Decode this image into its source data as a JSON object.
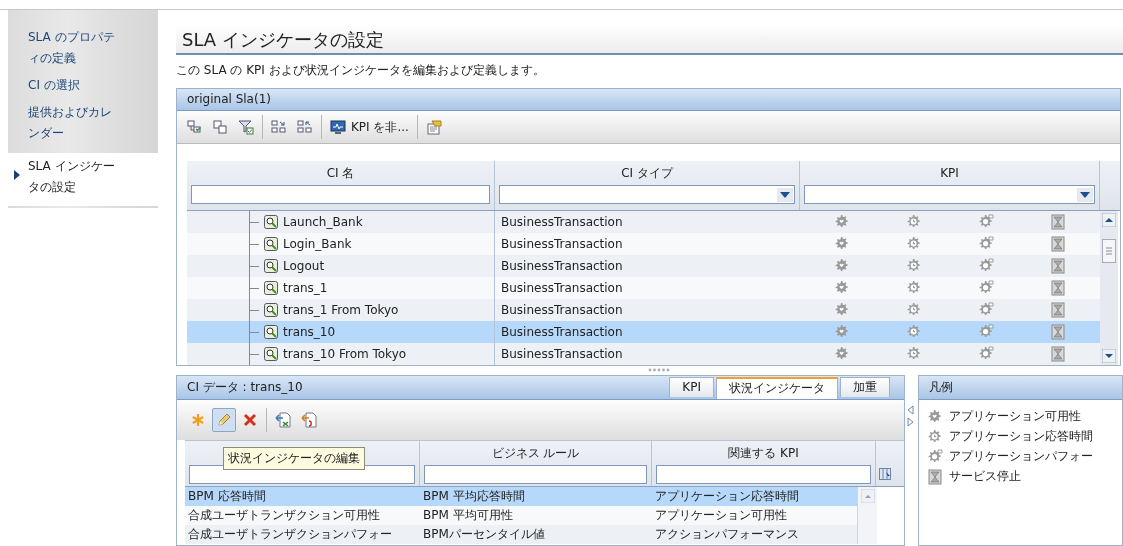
{
  "sidebar": {
    "items": [
      {
        "label": "SLA のプロパティの定義",
        "selected": false
      },
      {
        "label": "CI の選択",
        "selected": false
      },
      {
        "label": "提供およびカレンダー",
        "selected": false
      },
      {
        "label": "SLA インジケータの設定",
        "selected": true
      }
    ]
  },
  "page": {
    "title": "SLA インジケータの設定",
    "description": "この SLA の KPI および状況インジケータを編集および定義します。"
  },
  "sla_panel": {
    "title": "original Sla(1)",
    "toolbar": [
      {
        "kind": "select-tree"
      },
      {
        "kind": "copy"
      },
      {
        "kind": "filter"
      },
      {
        "kind": "separator"
      },
      {
        "kind": "hierarchy-down"
      },
      {
        "kind": "hierarchy-up"
      },
      {
        "kind": "separator"
      },
      {
        "kind": "monitor",
        "label": "KPI を非..."
      },
      {
        "kind": "separator"
      },
      {
        "kind": "properties"
      }
    ],
    "columns": [
      {
        "label": "CI 名",
        "kind": "text-filter"
      },
      {
        "label": "CI タイプ",
        "kind": "dropdown-filter"
      },
      {
        "label": "KPI",
        "kind": "dropdown-filter"
      }
    ],
    "rows": [
      {
        "name": "Launch_Bank",
        "type": "BusinessTransaction",
        "selected": false
      },
      {
        "name": "Login_Bank",
        "type": "BusinessTransaction",
        "selected": false
      },
      {
        "name": "Logout",
        "type": "BusinessTransaction",
        "selected": false
      },
      {
        "name": "trans_1",
        "type": "BusinessTransaction",
        "selected": false
      },
      {
        "name": "trans_1 From Tokyo",
        "type": "BusinessTransaction",
        "selected": false
      },
      {
        "name": "trans_10",
        "type": "BusinessTransaction",
        "selected": true
      },
      {
        "name": "trans_10 From Tokyo",
        "type": "BusinessTransaction",
        "selected": false
      }
    ]
  },
  "details": {
    "title": "CI データ : trans_10",
    "tabs": [
      {
        "label": "KPI",
        "selected": false
      },
      {
        "label": "状況インジケータ",
        "selected": true
      },
      {
        "label": "加重",
        "selected": false
      }
    ],
    "toolbar": [
      {
        "kind": "new",
        "pressed": false
      },
      {
        "kind": "edit",
        "pressed": true
      },
      {
        "kind": "delete",
        "pressed": false
      },
      {
        "kind": "separator"
      },
      {
        "kind": "import",
        "pressed": false
      },
      {
        "kind": "export",
        "pressed": false
      }
    ],
    "tooltip": "状況インジケータの編集",
    "columns": [
      {
        "kind": "text-filter"
      },
      {
        "label": "ビジネス ルール",
        "kind": "text-filter"
      },
      {
        "label": "関連する KPI",
        "kind": "text-filter"
      }
    ],
    "rows": [
      {
        "cells": [
          "BPM 応答時間",
          "BPM 平均応答時間",
          "アプリケーション応答時間"
        ],
        "selected": true
      },
      {
        "cells": [
          "合成ユーザトランザクション可用性",
          "BPM 平均可用性",
          "アプリケーション可用性"
        ],
        "selected": false
      },
      {
        "cells": [
          "合成ユーザトランザクションパフォー",
          "BPMパーセンタイル値",
          "アクションパフォーマンス"
        ],
        "selected": false
      }
    ]
  },
  "legend": {
    "title": "凡例",
    "items": [
      {
        "kind": "availability",
        "label": "アプリケーション可用性"
      },
      {
        "kind": "response-time",
        "label": "アプリケーション応答時間"
      },
      {
        "kind": "performance",
        "label": "アプリケーションパフォー"
      },
      {
        "kind": "downtime",
        "label": "サービス停止"
      }
    ]
  }
}
